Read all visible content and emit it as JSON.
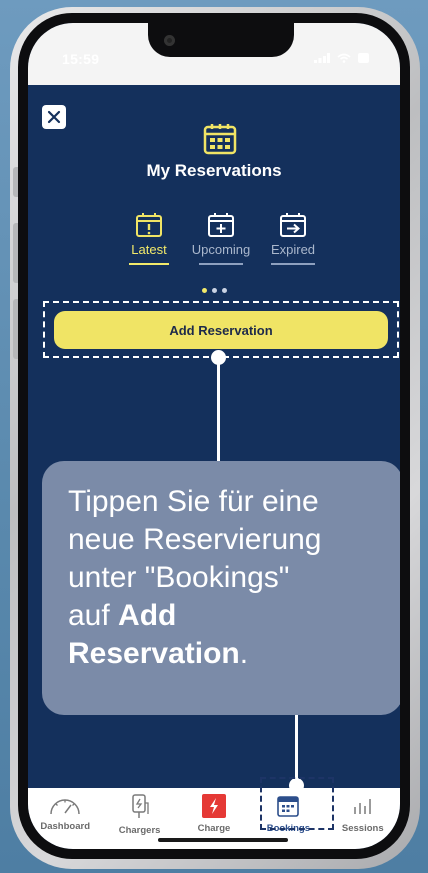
{
  "status_bar": {
    "time": "15:59"
  },
  "header": {
    "title": "My Reservations"
  },
  "tabs": [
    {
      "label": "Latest",
      "icon": "calendar-alert-icon",
      "active": true
    },
    {
      "label": "Upcoming",
      "icon": "calendar-plus-icon",
      "active": false
    },
    {
      "label": "Expired",
      "icon": "calendar-arrow-icon",
      "active": false
    }
  ],
  "actions": {
    "add_reservation_label": "Add Reservation"
  },
  "tooltip": {
    "line1": "Tippen Sie für eine",
    "line2": "neue Reservierung",
    "line3": "unter \"Bookings\"",
    "line4_prefix": "auf ",
    "line4_bold": "Add",
    "line5_bold": "Reservation",
    "line5_suffix": "."
  },
  "bottom_nav": [
    {
      "label": "Dashboard",
      "icon": "gauge-icon",
      "active": false
    },
    {
      "label": "Chargers",
      "icon": "charger-icon",
      "active": false
    },
    {
      "label": "Charge",
      "icon": "lightning-icon",
      "active": false
    },
    {
      "label": "Bookings",
      "icon": "calendar-icon",
      "active": true
    },
    {
      "label": "Sessions",
      "icon": "bar-chart-icon",
      "active": false
    }
  ],
  "colors": {
    "app_bg": "#14305c",
    "accent_yellow": "#f0e465",
    "tooltip_bg": "#7b8ba8",
    "charge_red": "#e53935",
    "nav_active": "#2c4e8b"
  }
}
